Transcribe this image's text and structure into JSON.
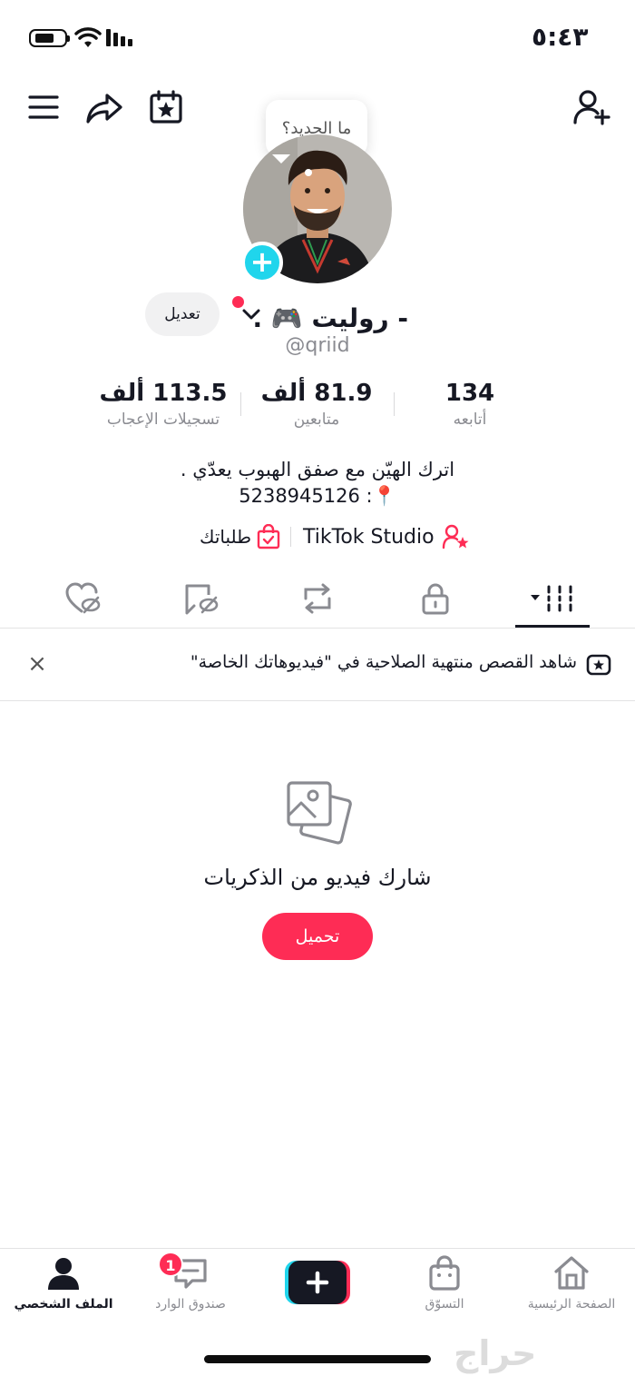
{
  "status_bar": {
    "time": "٥:٤٣"
  },
  "tooltip": {
    "text": "ما الجديد؟"
  },
  "profile": {
    "name": "- روليت 🎮 .",
    "handle": "@qriid",
    "edit_label": "تعديل",
    "bio_line1": "اترك الهيّن مع صفق الهبوب يعدّي .",
    "bio_line2": "📍: 5238945126",
    "studio_label": "TikTok Studio",
    "orders_label": "طلباتك"
  },
  "stats": [
    {
      "value": "134",
      "label": "أتابعه"
    },
    {
      "value": "81.9 ألف",
      "label": "متابعين"
    },
    {
      "value": "113.5 ألف",
      "label": "تسجيلات الإعجاب"
    }
  ],
  "tabs": [
    "videos-tab",
    "private-tab",
    "reposts-tab",
    "favorites-tab",
    "liked-tab"
  ],
  "banner": {
    "text": "شاهد القصص منتهية الصلاحية في \"فيديوهاتك الخاصة\"",
    "close": "×"
  },
  "empty_state": {
    "title": "شارك فيديو من الذكريات",
    "button": "تحميل"
  },
  "bottom_nav": {
    "home": "الصفحة الرئيسية",
    "shop": "التسوّق",
    "inbox": "صندوق الوارد",
    "inbox_badge": "1",
    "profile": "الملف الشخصي"
  },
  "watermark": "حراج",
  "colors": {
    "accent": "#fe2c55",
    "cyan": "#20d5ec",
    "text": "#161823",
    "muted": "#8a8b91"
  }
}
